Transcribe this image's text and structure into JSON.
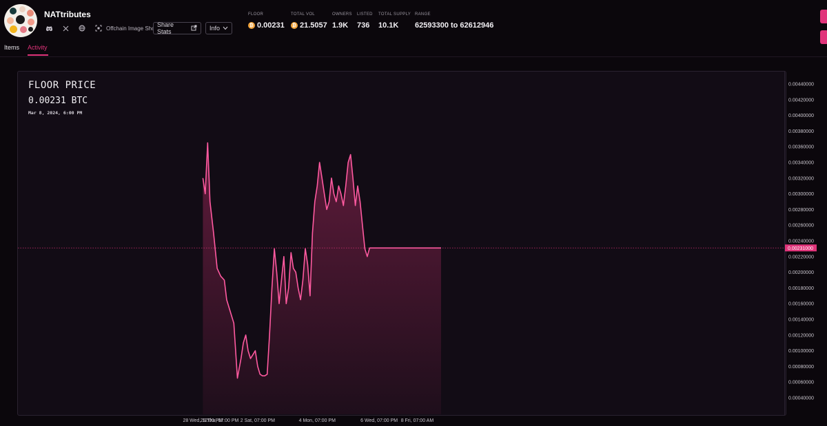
{
  "header": {
    "collection_name": "NATtributes",
    "offchain_label": "Offchain Image Shown",
    "share_label": "Share Stats",
    "info_label": "Info",
    "icons": [
      "discord-icon",
      "x-twitter-icon",
      "globe-icon",
      "offchain-image-icon",
      "share-icon",
      "chevron-down-icon"
    ]
  },
  "stats": {
    "floor": {
      "label": "FLOOR",
      "value": "0.00231"
    },
    "total_vol": {
      "label": "TOTAL VOL",
      "value": "21.5057"
    },
    "owners": {
      "label": "OWNERS",
      "value": "1.9K"
    },
    "listed": {
      "label": "LISTED",
      "value": "736"
    },
    "total_supply": {
      "label": "TOTAL SUPPLY",
      "value": "10.1K"
    },
    "range": {
      "label": "RANGE",
      "value": "62593300 to 62612946"
    }
  },
  "tabs": {
    "items": "Items",
    "activity": "Activity",
    "active": "Activity"
  },
  "colors": {
    "accent": "#e0347a",
    "line": "#ff5aa0",
    "bg": "#0b070c",
    "panel": "#120c15",
    "btc": "#f2a33a"
  },
  "chart_panel": {
    "title": "FLOOR PRICE",
    "value": "0.00231 BTC",
    "date": "Mar 8, 2024, 6:00 PM"
  },
  "chart_data": {
    "type": "area",
    "y_ticks": [
      "0.00440000",
      "0.00420000",
      "0.00400000",
      "0.00380000",
      "0.00360000",
      "0.00340000",
      "0.00320000",
      "0.00300000",
      "0.00280000",
      "0.00260000",
      "0.00240000",
      "0.00220000",
      "0.00200000",
      "0.00180000",
      "0.00160000",
      "0.00140000",
      "0.00120000",
      "0.00100000",
      "0.00080000",
      "0.00060000",
      "0.00040000"
    ],
    "ylim": [
      0.00029,
      0.0045
    ],
    "current_value_label": "0.00231000",
    "current_value": 0.00231,
    "x_ticks": [
      "28 Wed, 12:00 PM",
      "29 Thu, 07:00 PM",
      "2 Sat, 07:00 PM",
      "4 Mon, 07:00 PM",
      "6 Wed, 07:00 PM",
      "8 Fri, 07:00 AM"
    ],
    "x_tick_t": [
      0.0,
      0.07,
      0.23,
      0.48,
      0.74,
      0.9
    ],
    "t_range": [
      -0.03,
      1.0
    ],
    "series": [
      {
        "t": [
          0.0,
          0.01,
          0.02,
          0.03,
          0.045,
          0.06,
          0.075,
          0.09,
          0.1,
          0.115,
          0.13,
          0.145,
          0.16,
          0.17,
          0.18,
          0.19,
          0.2,
          0.21,
          0.22,
          0.23,
          0.24,
          0.25,
          0.26,
          0.27,
          0.28,
          0.29,
          0.3,
          0.31,
          0.32,
          0.33,
          0.34,
          0.35,
          0.36,
          0.37,
          0.38,
          0.39,
          0.4,
          0.41,
          0.42,
          0.43,
          0.44,
          0.45,
          0.46,
          0.47,
          0.48,
          0.49,
          0.5,
          0.51,
          0.52,
          0.53,
          0.54,
          0.55,
          0.56,
          0.57,
          0.58,
          0.59,
          0.6,
          0.61,
          0.62,
          0.63,
          0.64,
          0.65,
          0.66,
          0.67,
          0.68,
          0.69,
          0.7,
          0.71,
          0.72,
          0.73,
          0.74,
          0.75,
          0.76,
          0.77,
          0.78,
          0.79,
          0.8,
          0.81,
          0.82,
          0.83,
          0.84,
          0.85,
          0.86,
          0.87,
          0.88,
          0.89,
          0.9,
          0.91,
          0.92,
          0.93,
          0.94,
          0.95,
          0.96,
          0.97,
          0.98,
          0.99,
          1.0
        ],
        "y": [
          0.0032,
          0.003,
          0.00365,
          0.0029,
          0.0025,
          0.00205,
          0.00195,
          0.0019,
          0.00165,
          0.0015,
          0.00135,
          0.00065,
          0.0009,
          0.0011,
          0.0012,
          0.001,
          0.0009,
          0.00095,
          0.001,
          0.0008,
          0.0007,
          0.00068,
          0.00068,
          0.0007,
          0.0012,
          0.0018,
          0.0023,
          0.002,
          0.0016,
          0.0019,
          0.0022,
          0.0016,
          0.0018,
          0.00225,
          0.00205,
          0.002,
          0.0018,
          0.00165,
          0.0019,
          0.0023,
          0.0021,
          0.0017,
          0.0025,
          0.0029,
          0.0031,
          0.0034,
          0.0032,
          0.003,
          0.0028,
          0.0029,
          0.0032,
          0.003,
          0.0029,
          0.0031,
          0.003,
          0.00285,
          0.0031,
          0.0034,
          0.0035,
          0.0032,
          0.00285,
          0.0031,
          0.0029,
          0.0026,
          0.0023,
          0.0022,
          0.00231,
          0.00231,
          0.00231,
          0.00231,
          0.00231,
          0.00231,
          0.00231,
          0.00231,
          0.00231,
          0.00231,
          0.00231,
          0.00231,
          0.00231,
          0.00231,
          0.00231,
          0.00231,
          0.00231,
          0.00231,
          0.00231,
          0.00231,
          0.00231,
          0.00231,
          0.00231,
          0.00231,
          0.00231,
          0.00231,
          0.00231,
          0.00231,
          0.00231,
          0.00231,
          0.00231
        ]
      }
    ],
    "grid": false
  }
}
